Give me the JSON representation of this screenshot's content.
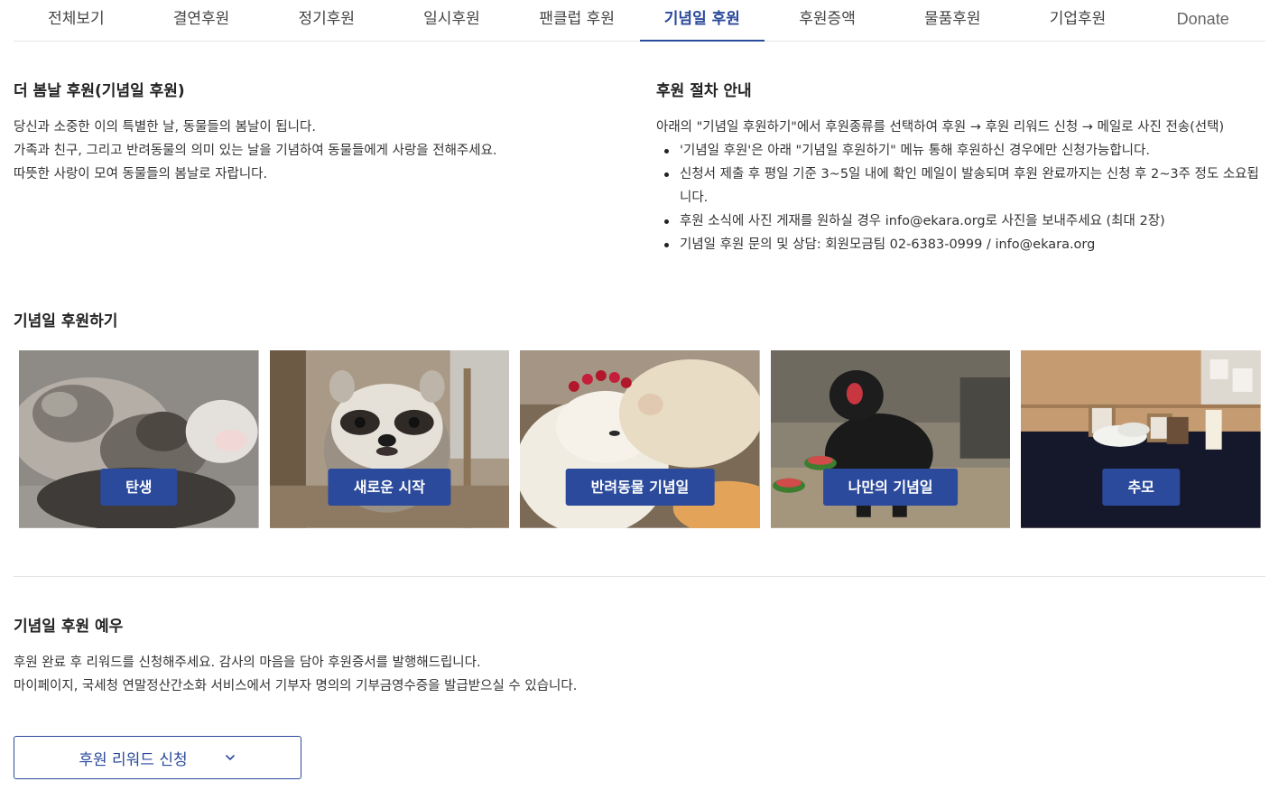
{
  "tabs": [
    {
      "label": "전체보기"
    },
    {
      "label": "결연후원"
    },
    {
      "label": "정기후원"
    },
    {
      "label": "일시후원"
    },
    {
      "label": "팬클럽 후원"
    },
    {
      "label": "기념일 후원",
      "active": true
    },
    {
      "label": "후원증액"
    },
    {
      "label": "물품후원"
    },
    {
      "label": "기업후원"
    },
    {
      "label": "Donate"
    }
  ],
  "intro": {
    "title": "더 봄날 후원(기념일 후원)",
    "lines": [
      "당신과 소중한 이의 특별한 날, 동물들의 봄날이 됩니다.",
      "가족과 친구, 그리고 반려동물의 의미 있는 날을 기념하여 동물들에게 사랑을 전해주세요.",
      "따뜻한 사랑이 모여 동물들의 봄날로 자랍니다."
    ]
  },
  "procedure": {
    "title": "후원 절차 안내",
    "description": "아래의 \"기념일 후원하기\"에서 후원종류를 선택하여 후원 → 후원 리워드 신청 → 메일로 사진 전송(선택)",
    "bullets": [
      "'기념일 후원'은 아래 \"기념일 후원하기\" 메뉴 통해 후원하신 경우에만 신청가능합니다.",
      "신청서 제출 후 평일 기준 3~5일 내에 확인 메일이 발송되며 후원 완료까지는 신청 후 2~3주 정도 소요됩니다.",
      "후원 소식에 사진 게재를 원하실 경우 info@ekara.org로 사진을 보내주세요 (최대 2장)",
      "기념일 후원 문의 및 상담: 회원모금팀 02-6383-0999 / info@ekara.org"
    ]
  },
  "donate_section": {
    "title": "기념일 후원하기",
    "cards": [
      {
        "label": "탄생",
        "image": "sleeping-kittens"
      },
      {
        "label": "새로운 시작",
        "image": "raccoon"
      },
      {
        "label": "반려동물 기념일",
        "image": "two-white-dogs"
      },
      {
        "label": "나만의 기념일",
        "image": "black-bear"
      },
      {
        "label": "추모",
        "image": "memorial-table"
      }
    ]
  },
  "etiquette": {
    "title": "기념일 후원 예우",
    "lines": [
      "후원 완료 후 리워드를 신청해주세요. 감사의 마음을 담아 후원증서를 발행해드립니다.",
      "마이페이지, 국세청 연말정산간소화 서비스에서 기부자 명의의 기부금영수증을 발급받으실 수 있습니다."
    ],
    "reward_button": "후원 리워드 신청"
  },
  "colors": {
    "accent": "#2b4a9b",
    "text": "#333333",
    "divider": "#e3e3e3"
  }
}
